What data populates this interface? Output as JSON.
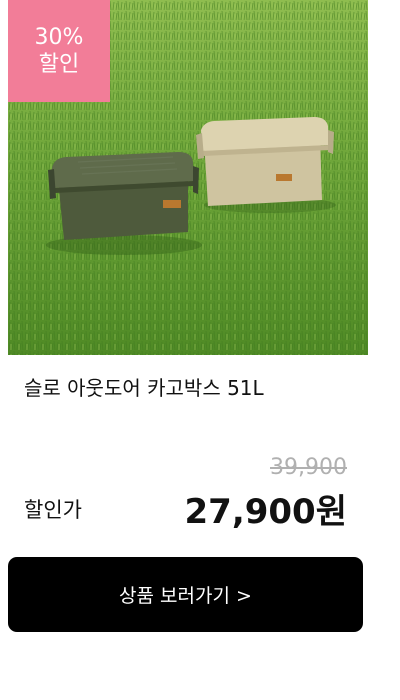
{
  "badge": {
    "percent": "30%",
    "label": "할인"
  },
  "product": {
    "name": "슬로 아웃도어 카고박스 51L",
    "image_icon": "product-photo-storage-boxes"
  },
  "price": {
    "original": "39,900",
    "sale_label": "할인가",
    "sale": "27,900원"
  },
  "button": {
    "label": "상품 보러가기 >"
  },
  "colors": {
    "badge": "#f27d98",
    "button": "#000000",
    "original_price": "#b0b0b0"
  }
}
